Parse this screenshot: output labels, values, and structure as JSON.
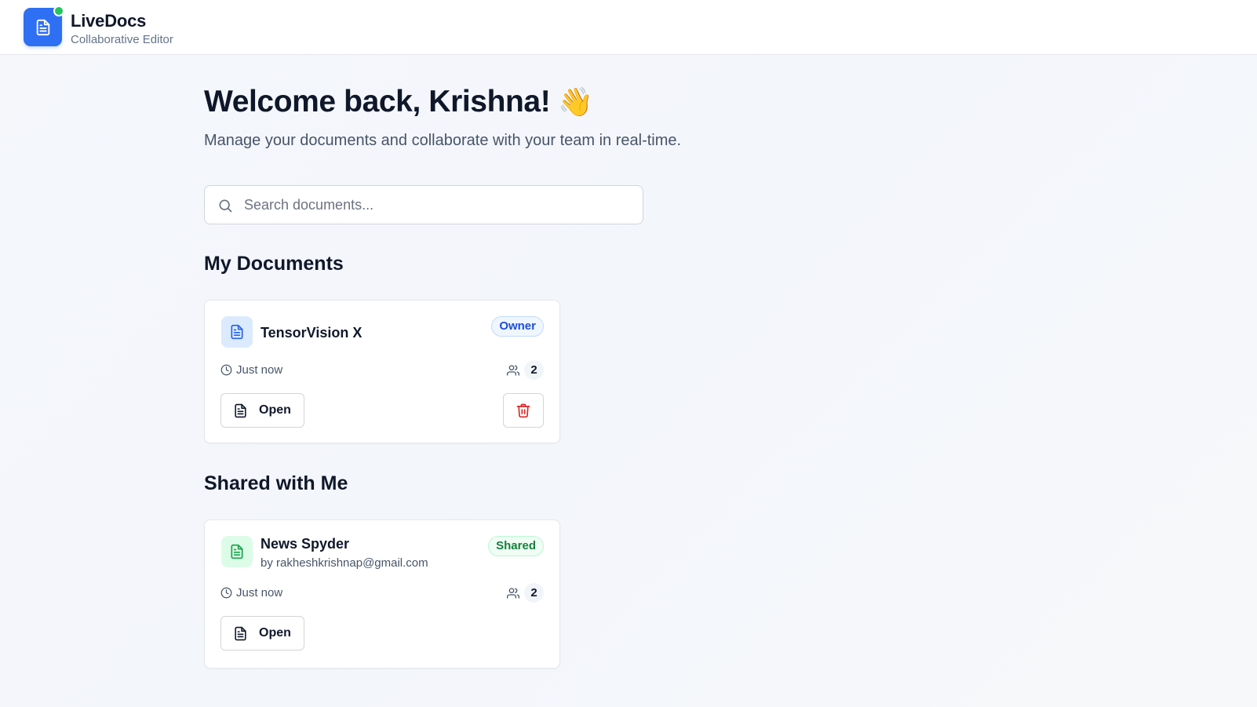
{
  "app": {
    "name": "LiveDocs",
    "subtitle": "Collaborative Editor",
    "accent_color": "#2f6ff3",
    "status_color": "#22c55e",
    "logo_icon": "document-icon"
  },
  "hero": {
    "welcome": "Welcome back, Krishna!",
    "wave_emoji": "👋",
    "subtitle": "Manage your documents and collaborate with your team in real-time."
  },
  "search": {
    "placeholder": "Search documents...",
    "value": "",
    "icon": "search-icon"
  },
  "my_documents": {
    "title": "My Documents",
    "items": [
      {
        "title": "TensorVision X",
        "badge": "Owner",
        "time": "Just now",
        "collaborators": "2",
        "open_label": "Open",
        "delete_icon": "trash-icon"
      }
    ]
  },
  "shared_with_me": {
    "title": "Shared with Me",
    "items": [
      {
        "title": "News Spyder",
        "owner": "by rakheshkrishnap@gmail.com",
        "badge": "Shared",
        "time": "Just now",
        "collaborators": "2",
        "open_label": "Open"
      }
    ]
  }
}
